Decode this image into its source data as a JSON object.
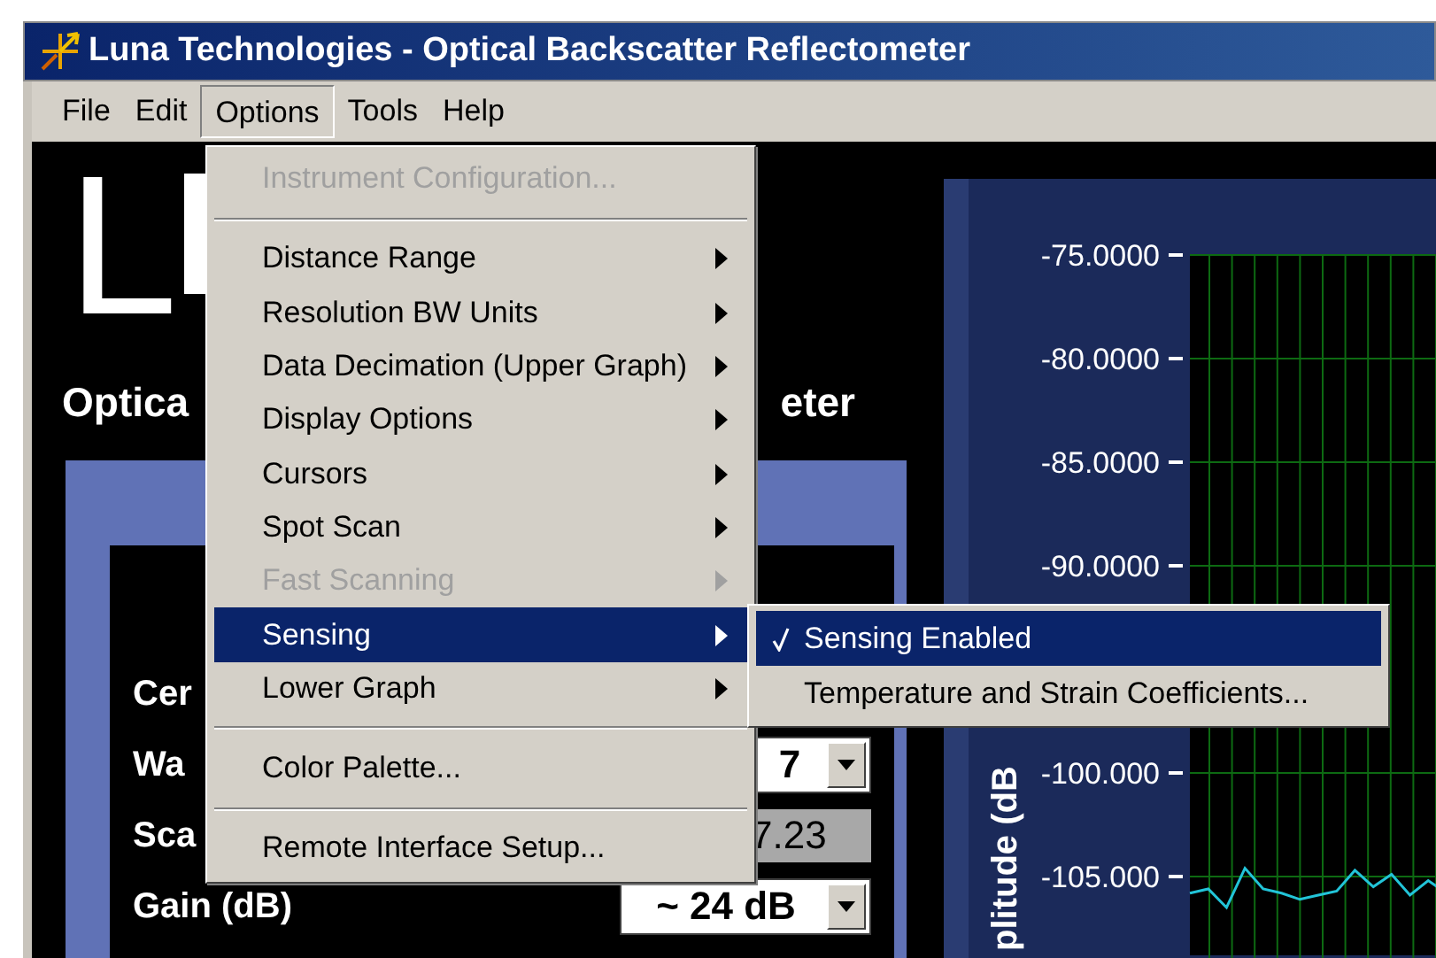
{
  "window": {
    "title": "Luna Technologies - Optical Backscatter Reflectometer"
  },
  "menu_bar": [
    {
      "label": "File",
      "selected": false
    },
    {
      "label": "Edit",
      "selected": false
    },
    {
      "label": "Options",
      "selected": true
    },
    {
      "label": "Tools",
      "selected": false
    },
    {
      "label": "Help",
      "selected": false
    }
  ],
  "options_menu": [
    {
      "kind": "item",
      "label": "Instrument Configuration...",
      "disabled": true,
      "submenu": false,
      "selected": false
    },
    {
      "kind": "separator"
    },
    {
      "kind": "item",
      "label": "Distance Range",
      "disabled": false,
      "submenu": true,
      "selected": false
    },
    {
      "kind": "item",
      "label": "Resolution BW Units",
      "disabled": false,
      "submenu": true,
      "selected": false
    },
    {
      "kind": "item",
      "label": "Data Decimation (Upper Graph)",
      "disabled": false,
      "submenu": true,
      "selected": false
    },
    {
      "kind": "item",
      "label": "Display Options",
      "disabled": false,
      "submenu": true,
      "selected": false
    },
    {
      "kind": "item",
      "label": "Cursors",
      "disabled": false,
      "submenu": true,
      "selected": false
    },
    {
      "kind": "item",
      "label": "Spot Scan",
      "disabled": false,
      "submenu": true,
      "selected": false
    },
    {
      "kind": "item",
      "label": "Fast Scanning",
      "disabled": true,
      "submenu": true,
      "selected": false
    },
    {
      "kind": "item",
      "label": "Sensing",
      "disabled": false,
      "submenu": true,
      "selected": true
    },
    {
      "kind": "item",
      "label": "Lower Graph",
      "disabled": false,
      "submenu": true,
      "selected": false
    },
    {
      "kind": "separator"
    },
    {
      "kind": "item",
      "label": "Color Palette...",
      "disabled": false,
      "submenu": false,
      "selected": false
    },
    {
      "kind": "separator"
    },
    {
      "kind": "item",
      "label": "Remote Interface Setup...",
      "disabled": false,
      "submenu": false,
      "selected": false
    }
  ],
  "sensing_submenu": [
    {
      "label": "Sensing Enabled",
      "checked": true,
      "selected": true
    },
    {
      "label": "Temperature and Strain Coefficients...",
      "checked": false,
      "selected": false
    }
  ],
  "logo": "L",
  "heading": {
    "left_part": "Optica",
    "right_part": "eter"
  },
  "settings": [
    {
      "label": "Cer",
      "kind": "none"
    },
    {
      "label": "Wa",
      "kind": "dropdown",
      "value": "7"
    },
    {
      "label": "Sca",
      "kind": "display",
      "value": "7.23"
    },
    {
      "label": "Gain (dB)",
      "kind": "dropdown",
      "value": "~ 24 dB"
    }
  ],
  "graph": {
    "chart_data": {
      "type": "line",
      "grid": true,
      "ylabel": "plitude (dB",
      "ylim": [
        -108.8,
        -75
      ],
      "yticks": [
        {
          "value": -75,
          "label": "-75.0000"
        },
        {
          "value": -80,
          "label": "-80.0000"
        },
        {
          "value": -85,
          "label": "-85.0000"
        },
        {
          "value": -90,
          "label": "-90.0000"
        },
        {
          "value": -100,
          "label": "-100.000"
        },
        {
          "value": -105,
          "label": "-105.000"
        }
      ],
      "series": [
        {
          "color": "#22c4d8",
          "values": [
            -105.8,
            -105.6,
            -106.5,
            -104.6,
            -105.6,
            -105.8,
            -106.1,
            -105.9,
            -105.7,
            -104.7,
            -105.5,
            -104.9,
            -105.9,
            -105.2,
            -105.8
          ]
        }
      ]
    }
  }
}
